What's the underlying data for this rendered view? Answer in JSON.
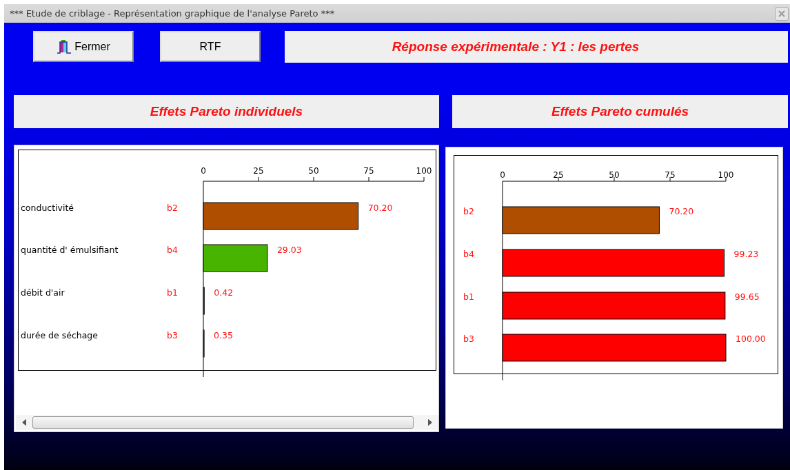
{
  "window": {
    "title": "*** Etude de criblage - Représentation graphique de l'analyse Pareto ***"
  },
  "toolbar": {
    "buttons": [
      {
        "kind": "close",
        "label": "Fermer"
      },
      {
        "kind": "plain",
        "label": "RTF"
      }
    ],
    "response": "Réponse expérimentale : Y1 : les pertes"
  },
  "individual": {
    "heading": "Effets Pareto individuels",
    "factors": [
      {
        "name": "conductivité",
        "color": "#b04e00"
      },
      {
        "name": "quantité d' émulsifiant",
        "color": "#48b400"
      },
      {
        "name": "débit d'air"
      },
      {
        "name": "durée de séchage"
      }
    ],
    "chart_data": {
      "type": "bar",
      "orientation": "horizontal",
      "categories": [
        "b2",
        "b4",
        "b1",
        "b3"
      ],
      "series": [
        {
          "values": [
            70.2,
            29.03,
            0.42,
            0.35
          ]
        }
      ],
      "xlim": [
        0,
        100
      ],
      "xticks": [
        0,
        25,
        50,
        75,
        100
      ],
      "value_labels": [
        "70.20",
        "29.03",
        "0.42",
        "0.35"
      ]
    }
  },
  "cumulative": {
    "heading": "Effets Pareto cumulés",
    "bars": [
      {
        "color": "#b04e00"
      },
      {
        "color": "#ff0000"
      },
      {
        "color": "#ff0000"
      },
      {
        "color": "#ff0000"
      }
    ],
    "chart_data": {
      "type": "bar",
      "orientation": "horizontal",
      "categories": [
        "b2",
        "b4",
        "b1",
        "b3"
      ],
      "series": [
        {
          "values": [
            70.2,
            99.23,
            99.65,
            100.0
          ]
        }
      ],
      "xlim": [
        0,
        100
      ],
      "xticks": [
        0,
        25,
        50,
        75,
        100
      ],
      "value_labels": [
        "70.20",
        "99.23",
        "99.65",
        "100.00"
      ]
    }
  }
}
